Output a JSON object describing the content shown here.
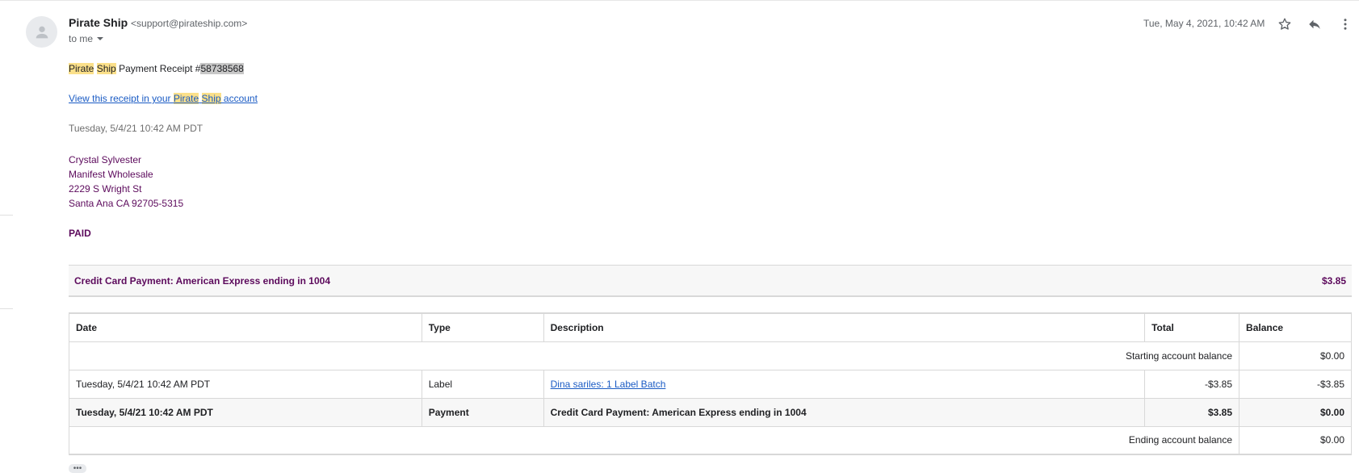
{
  "sender": {
    "name": "Pirate Ship",
    "email": "<support@pirateship.com>",
    "to_label": "to me"
  },
  "header": {
    "date": "Tue, May 4, 2021, 10:42 AM"
  },
  "icons": {
    "avatar": "person-icon",
    "star": "star-icon",
    "reply": "reply-icon",
    "more": "more-vert-icon",
    "expand": "chevron-down-icon"
  },
  "receipt": {
    "subject_word1": "Pirate",
    "subject_word2": "Ship",
    "subject_middle": "Payment Receipt #",
    "subject_number": "58738568",
    "view_link_prefix": "View this receipt in your ",
    "view_link_word1": "Pirate",
    "view_link_word2": "Ship",
    "view_link_suffix": " account",
    "timestamp": "Tuesday, 5/4/21 10:42 AM PDT",
    "address": [
      "Crystal Sylvester",
      "Manifest Wholesale",
      "2229 S Wright St",
      "Santa Ana CA 92705-5315"
    ],
    "status": "PAID",
    "payment_method": "Credit Card Payment: American Express ending in 1004",
    "payment_amount": "$3.85"
  },
  "ledger": {
    "headers": [
      "Date",
      "Type",
      "Description",
      "Total",
      "Balance"
    ],
    "starting_label": "Starting account balance",
    "starting_balance": "$0.00",
    "rows": [
      {
        "date": "Tuesday, 5/4/21 10:42 AM PDT",
        "type": "Label",
        "description": "Dina sariles: 1 Label Batch",
        "total": "-$3.85",
        "balance": "-$3.85"
      },
      {
        "date": "Tuesday, 5/4/21 10:42 AM PDT",
        "type": "Payment",
        "description": "Credit Card Payment: American Express ending in 1004",
        "total": "$3.85",
        "balance": "$0.00"
      }
    ],
    "ending_label": "Ending account balance",
    "ending_balance": "$0.00"
  },
  "more_label": "•••",
  "colors": {
    "highlight": "#fbe08a",
    "link": "#1a5bc4",
    "brand_purple": "#5c0a5c"
  }
}
